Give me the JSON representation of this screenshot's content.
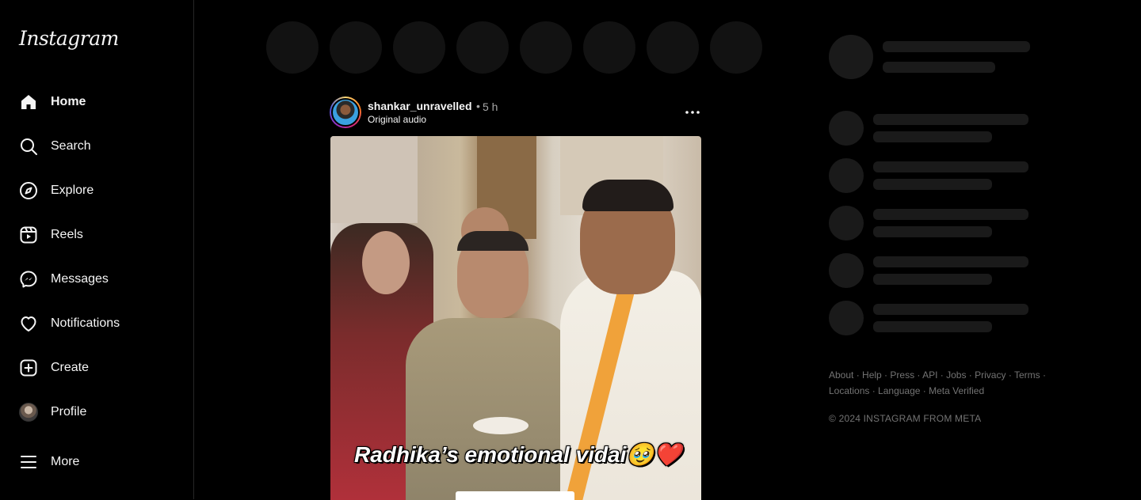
{
  "app": {
    "brand": "Instagram"
  },
  "sidebar": {
    "items": [
      {
        "label": "Home",
        "icon": "home-icon"
      },
      {
        "label": "Search",
        "icon": "search-icon"
      },
      {
        "label": "Explore",
        "icon": "compass-icon"
      },
      {
        "label": "Reels",
        "icon": "reels-icon"
      },
      {
        "label": "Messages",
        "icon": "messenger-icon"
      },
      {
        "label": "Notifications",
        "icon": "heart-icon"
      },
      {
        "label": "Create",
        "icon": "plus-square-icon"
      },
      {
        "label": "Profile",
        "icon": "avatar"
      },
      {
        "label": "More",
        "icon": "hamburger-icon"
      }
    ]
  },
  "post": {
    "username": "shankar_unravelled",
    "separator": "•",
    "time": "5 h",
    "audio": "Original audio",
    "caption": "Radhika’s emotional vidai🥹❤️"
  },
  "footer": {
    "links": [
      "About",
      "Help",
      "Press",
      "API",
      "Jobs",
      "Privacy",
      "Terms",
      "Locations",
      "Language",
      "Meta Verified"
    ],
    "copyright": "© 2024 INSTAGRAM FROM META"
  },
  "colors": {
    "background": "#000000",
    "text": "#f5f5f5",
    "muted": "#737373",
    "skeleton": "#1a1a1a"
  }
}
